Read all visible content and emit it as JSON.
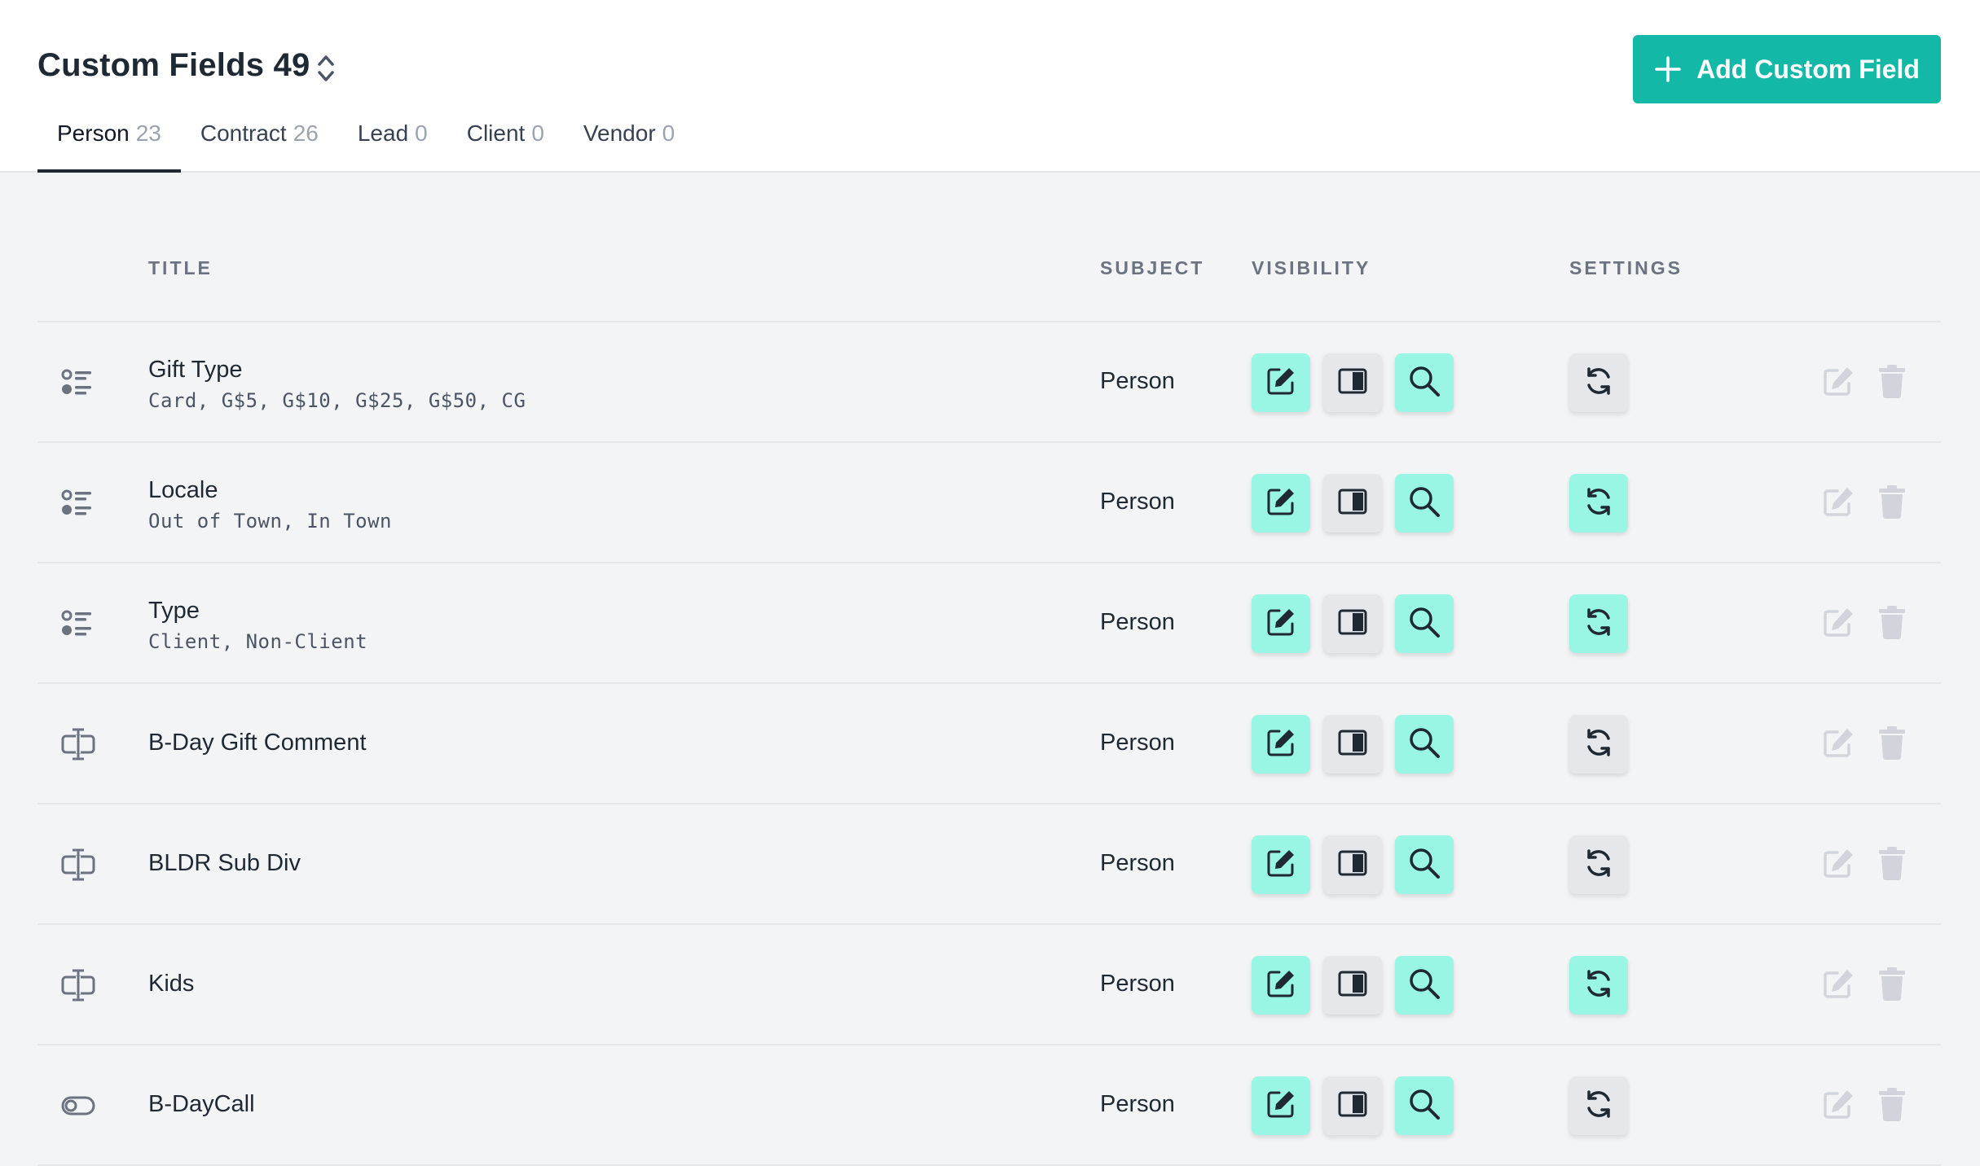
{
  "header": {
    "title": "Custom Fields 49",
    "add_button_label": "Add Custom Field",
    "tabs": [
      {
        "label": "Person",
        "count": "23",
        "active": true
      },
      {
        "label": "Contract",
        "count": "26",
        "active": false
      },
      {
        "label": "Lead",
        "count": "0",
        "active": false
      },
      {
        "label": "Client",
        "count": "0",
        "active": false
      },
      {
        "label": "Vendor",
        "count": "0",
        "active": false
      }
    ]
  },
  "table": {
    "columns": {
      "title": "TITLE",
      "subject": "SUBJECT",
      "visibility": "VISIBILITY",
      "settings": "SETTINGS"
    },
    "rows": [
      {
        "type_icon": "list-options-icon",
        "title": "Gift Type",
        "options": "Card, G$5, G$10, G$25, G$50, CG",
        "subject": "Person",
        "edit_on": true,
        "sidebar_on": false,
        "search_on": true,
        "sync_on": false
      },
      {
        "type_icon": "list-options-icon",
        "title": "Locale",
        "options": "Out of Town, In Town",
        "subject": "Person",
        "edit_on": true,
        "sidebar_on": false,
        "search_on": true,
        "sync_on": true
      },
      {
        "type_icon": "list-options-icon",
        "title": "Type",
        "options": "Client, Non-Client",
        "subject": "Person",
        "edit_on": true,
        "sidebar_on": false,
        "search_on": true,
        "sync_on": true
      },
      {
        "type_icon": "text-field-icon",
        "title": "B-Day Gift Comment",
        "options": "",
        "subject": "Person",
        "edit_on": true,
        "sidebar_on": false,
        "search_on": true,
        "sync_on": false
      },
      {
        "type_icon": "text-field-icon",
        "title": "BLDR Sub Div",
        "options": "",
        "subject": "Person",
        "edit_on": true,
        "sidebar_on": false,
        "search_on": true,
        "sync_on": false
      },
      {
        "type_icon": "text-field-icon",
        "title": "Kids",
        "options": "",
        "subject": "Person",
        "edit_on": true,
        "sidebar_on": false,
        "search_on": true,
        "sync_on": true
      },
      {
        "type_icon": "toggle-field-icon",
        "title": "B-DayCall",
        "options": "",
        "subject": "Person",
        "edit_on": true,
        "sidebar_on": false,
        "search_on": true,
        "sync_on": false
      }
    ]
  },
  "colors": {
    "accent": "#14b8a6",
    "active_toggle": "#99f6e4",
    "inactive_toggle": "#e5e7eb"
  }
}
